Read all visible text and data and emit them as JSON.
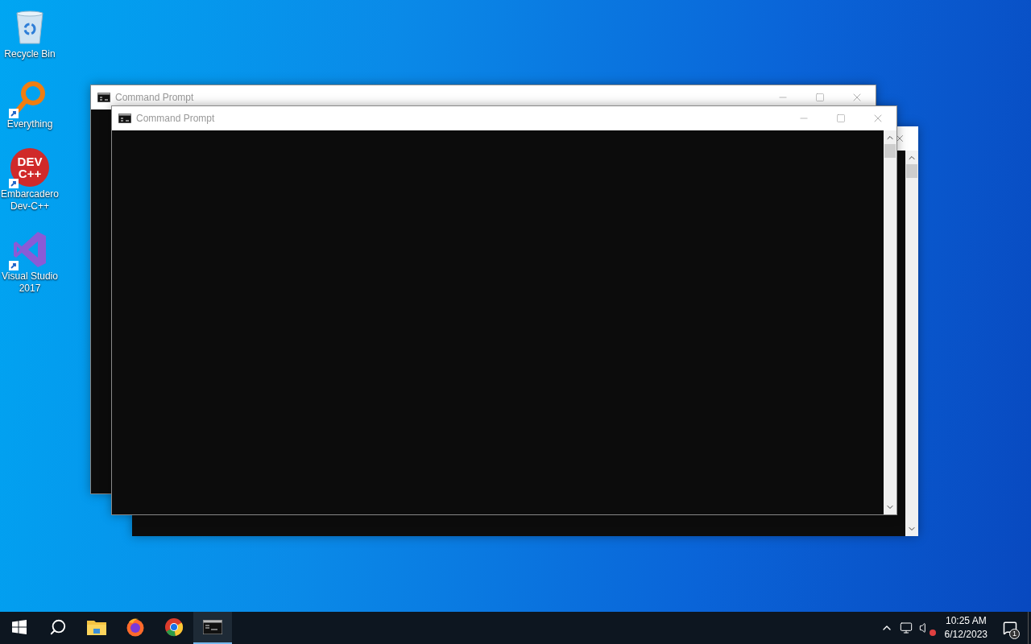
{
  "desktop_icons": [
    {
      "label": "Recycle Bin",
      "kind": "recycle",
      "shortcut": false
    },
    {
      "label": "Everything",
      "kind": "magnifier",
      "shortcut": true
    },
    {
      "label": "Embarcadero Dev-C++",
      "kind": "devcpp",
      "shortcut": true,
      "logo_text": [
        "DEV",
        "C++"
      ]
    },
    {
      "label": "Visual Studio 2017",
      "kind": "vs",
      "shortcut": true
    }
  ],
  "windows": [
    {
      "kind": "back",
      "title": "Command Prompt"
    },
    {
      "kind": "behind"
    },
    {
      "kind": "front",
      "title": "Command Prompt"
    }
  ],
  "taskbar": {
    "items": [
      {
        "kind": "start",
        "active": false
      },
      {
        "kind": "search",
        "active": false
      },
      {
        "kind": "explorer",
        "active": false
      },
      {
        "kind": "firefox",
        "active": false
      },
      {
        "kind": "chrome",
        "active": false
      },
      {
        "kind": "terminal",
        "active": true
      }
    ],
    "tray": {
      "time": "10:25 AM",
      "date": "6/12/2023",
      "notification_count": "1"
    }
  }
}
